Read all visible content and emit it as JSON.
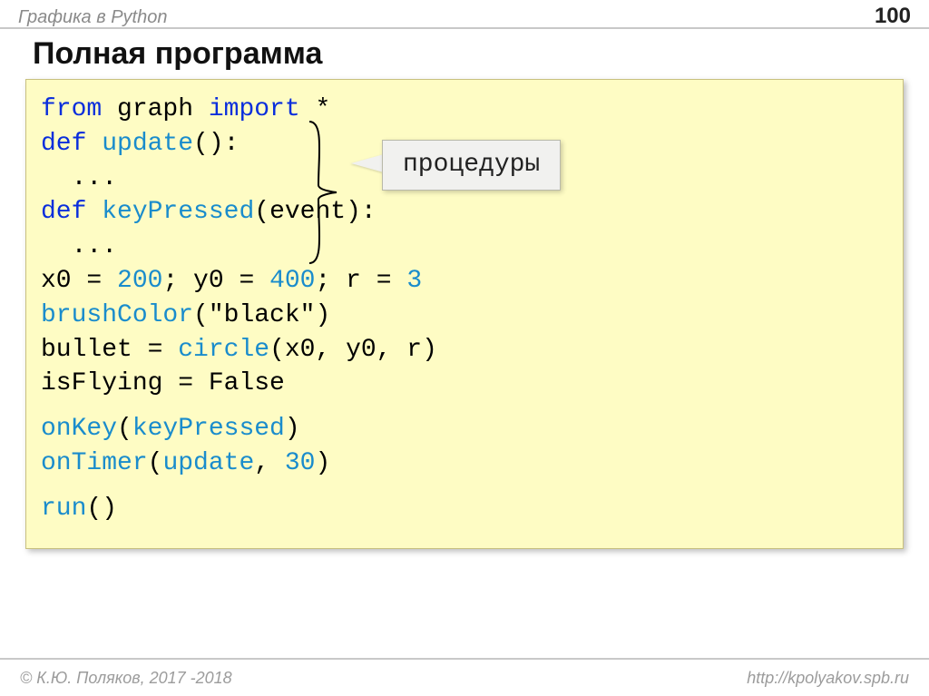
{
  "header": {
    "title": "Графика в Python",
    "page": "100"
  },
  "title": "Полная программа",
  "callout": "процедуры",
  "code": {
    "l1_from": "from",
    "l1_graph": " graph ",
    "l1_import": "import",
    "l1_star": " *",
    "l2_def": "def",
    "l2_update": " update",
    "l2_paren": "():",
    "l3": "  ...",
    "l4_def": "def",
    "l4_kp": " keyPressed",
    "l4_paren": "(event):",
    "l5": "  ...",
    "l6_a": "x0 = ",
    "l6_n1": "200",
    "l6_b": "; y0 = ",
    "l6_n2": "400",
    "l6_c": "; r = ",
    "l6_n3": "3",
    "l7_a": "brushColor",
    "l7_b": "(\"black\")",
    "l8_a": "bullet = ",
    "l8_b": "circle",
    "l8_c": "(x0, y0, r)",
    "l9": "isFlying = False",
    "l10_a": "onKey",
    "l10_b": "(",
    "l10_c": "keyPressed",
    "l10_d": ")",
    "l11_a": "onTimer",
    "l11_b": "(",
    "l11_c": "update",
    "l11_d": ", ",
    "l11_e": "30",
    "l11_f": ")",
    "l12_a": "run",
    "l12_b": "()"
  },
  "footer": {
    "left": "© К.Ю. Поляков, 2017 -2018",
    "right": "http://kpolyakov.spb.ru"
  }
}
